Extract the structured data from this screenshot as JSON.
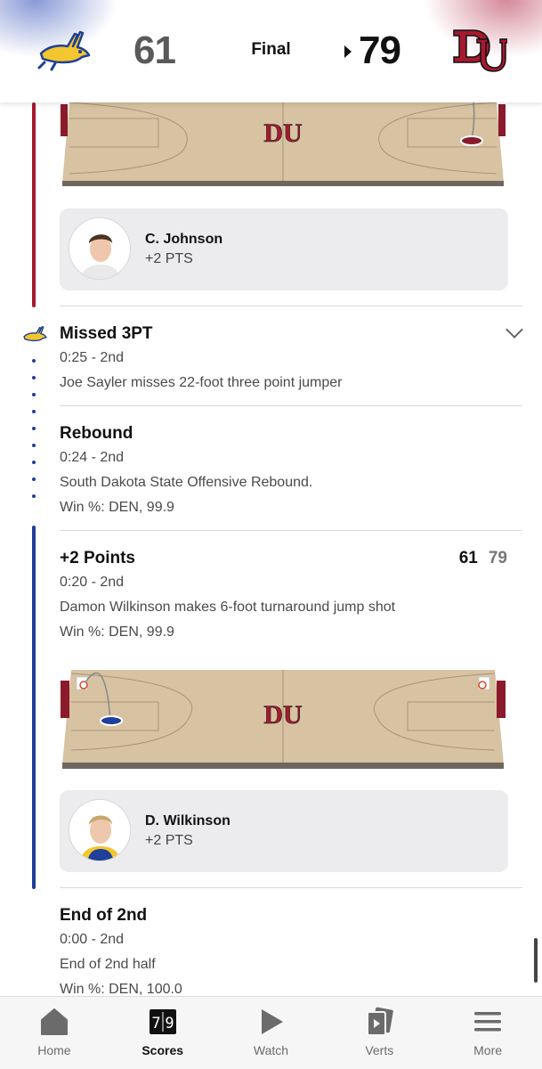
{
  "header": {
    "away_score": "61",
    "home_score": "79",
    "status": "Final",
    "colors": {
      "away": "#1e3f9a",
      "home": "#a6192e"
    }
  },
  "cards": [
    {
      "player": "C. Johnson",
      "points": "+2 PTS"
    },
    {
      "player": "D. Wilkinson",
      "points": "+2 PTS"
    }
  ],
  "plays": [
    {
      "title": "Missed 3PT",
      "time": "0:25 - 2nd",
      "description": "Joe Sayler misses 22-foot three point jumper",
      "team_icon": "sdsu-jackrabbit-icon"
    },
    {
      "title": "Rebound",
      "time": "0:24 - 2nd",
      "description": "South Dakota State Offensive Rebound.",
      "win_pct": "Win %: DEN, 99.9"
    },
    {
      "title": "+2 Points",
      "time": "0:20 - 2nd",
      "description": "Damon Wilkinson makes 6-foot turnaround jump shot",
      "win_pct": "Win %: DEN, 99.9",
      "score_away": "61",
      "score_home": "79"
    },
    {
      "title": "End of 2nd",
      "time": "0:00 - 2nd",
      "description": "End of 2nd half",
      "win_pct": "Win %: DEN, 100.0"
    }
  ],
  "tabs": [
    {
      "label": "Home",
      "icon": "home-icon"
    },
    {
      "label": "Scores",
      "icon": "scoreboard-icon",
      "active": true
    },
    {
      "label": "Watch",
      "icon": "play-icon"
    },
    {
      "label": "Verts",
      "icon": "verts-icon"
    },
    {
      "label": "More",
      "icon": "menu-icon"
    }
  ]
}
